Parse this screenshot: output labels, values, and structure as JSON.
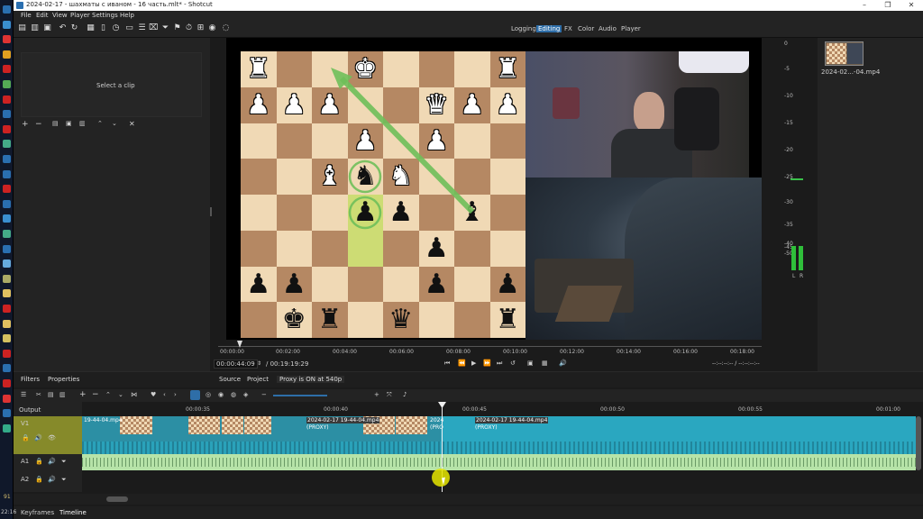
{
  "window": {
    "title": "2024-02-17 - шахматы с иваном - 16 часть.mlt* - Shotcut",
    "ctl_min": "–",
    "ctl_max": "❐",
    "ctl_close": "✕"
  },
  "menu": [
    "File",
    "Edit",
    "View",
    "Player",
    "Settings",
    "Help"
  ],
  "layouts": [
    "Logging",
    "Editing",
    "FX",
    "Color",
    "Audio",
    "Player"
  ],
  "left": {
    "select_clip": "Select a clip"
  },
  "timecode": {
    "current": "00:00:44:09",
    "total": "/ 00:19:19:29",
    "right": "--:--:--:-- / --:--:--:--"
  },
  "ruler_labels": [
    "00:00:00",
    "00:02:00",
    "00:04:00",
    "00:06:00",
    "00:08:00",
    "00:10:00",
    "00:12:00",
    "00:14:00",
    "00:16:00",
    "00:18:00"
  ],
  "viewer_tabs": {
    "source": "Source",
    "project": "Project",
    "proxy": "Proxy is ON at 540p"
  },
  "meters": {
    "scale": [
      "0",
      "-5",
      "-10",
      "-15",
      "-20",
      "-25",
      "-30",
      "-35",
      "-40",
      "-45",
      "-50"
    ],
    "left": "L",
    "right": "R"
  },
  "playlist": {
    "item": "2024-02...-04.mp4"
  },
  "panel_tabs": {
    "filters": "Filters",
    "properties": "Properties"
  },
  "timeline": {
    "ruler": [
      "00:00:35",
      "00:00:40",
      "00:00:45",
      "00:00:50",
      "00:00:55",
      "00:01:00"
    ],
    "tracks": {
      "output": "Output",
      "v1": "V1",
      "a1": "A1",
      "a2": "A2"
    },
    "clip_first": "19-44-04.mp4",
    "clip_mid": "2024-02-17 19-44-04.mp4",
    "clip_mid_proxy": "(PROXY)",
    "clip_short": "2024",
    "clip_short_proxy": "(PRO",
    "clip_right": "2024-02-17 19-44-04.mp4",
    "clip_right_proxy": "(PROXY)"
  },
  "bottom_tabs": {
    "keyframes": "Keyframes",
    "timeline": "Timeline"
  },
  "taskbar": {
    "time": "22:16",
    "num": "91"
  },
  "board": {
    "pieces": [
      {
        "r": 0,
        "c": 0,
        "g": "♜",
        "side": "w"
      },
      {
        "r": 0,
        "c": 3,
        "g": "♚",
        "side": "w"
      },
      {
        "r": 0,
        "c": 7,
        "g": "♜",
        "side": "w"
      },
      {
        "r": 1,
        "c": 0,
        "g": "♟",
        "side": "w"
      },
      {
        "r": 1,
        "c": 1,
        "g": "♟",
        "side": "w"
      },
      {
        "r": 1,
        "c": 2,
        "g": "♟",
        "side": "w"
      },
      {
        "r": 1,
        "c": 5,
        "g": "♛",
        "side": "w"
      },
      {
        "r": 1,
        "c": 6,
        "g": "♟",
        "side": "w"
      },
      {
        "r": 1,
        "c": 7,
        "g": "♟",
        "side": "w"
      },
      {
        "r": 2,
        "c": 3,
        "g": "♟",
        "side": "w"
      },
      {
        "r": 2,
        "c": 5,
        "g": "♟",
        "side": "w"
      },
      {
        "r": 3,
        "c": 2,
        "g": "♝",
        "side": "w"
      },
      {
        "r": 3,
        "c": 3,
        "g": "♞",
        "side": "b"
      },
      {
        "r": 3,
        "c": 4,
        "g": "♞",
        "side": "w"
      },
      {
        "r": 4,
        "c": 3,
        "g": "♟",
        "side": "b"
      },
      {
        "r": 4,
        "c": 4,
        "g": "♟",
        "side": "b"
      },
      {
        "r": 4,
        "c": 6,
        "g": "♝",
        "side": "b"
      },
      {
        "r": 5,
        "c": 5,
        "g": "♟",
        "side": "b"
      },
      {
        "r": 6,
        "c": 0,
        "g": "♟",
        "side": "b"
      },
      {
        "r": 6,
        "c": 1,
        "g": "♟",
        "side": "b"
      },
      {
        "r": 6,
        "c": 5,
        "g": "♟",
        "side": "b"
      },
      {
        "r": 6,
        "c": 7,
        "g": "♟",
        "side": "b"
      },
      {
        "r": 7,
        "c": 1,
        "g": "♚",
        "side": "b"
      },
      {
        "r": 7,
        "c": 2,
        "g": "♜",
        "side": "b"
      },
      {
        "r": 7,
        "c": 4,
        "g": "♛",
        "side": "b"
      },
      {
        "r": 7,
        "c": 7,
        "g": "♜",
        "side": "b"
      }
    ]
  },
  "colors": {
    "light": "#f0d9b5",
    "dark": "#b58863",
    "highlight": "#cddc74",
    "arrow": "#6fbf5a",
    "accent": "#2e6ea8",
    "video_track": "#2aa7c0",
    "audio_track": "#b6e3a8"
  }
}
